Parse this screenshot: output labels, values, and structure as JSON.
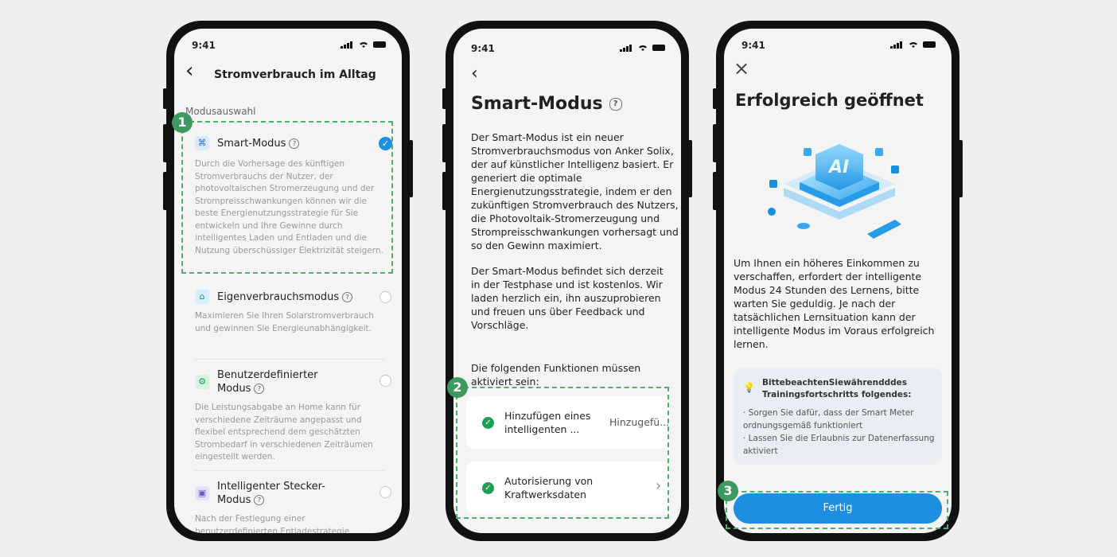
{
  "status": {
    "time": "9:41"
  },
  "screen1": {
    "back_label": "‹",
    "title": "Stromverbrauch im Alltag",
    "section_label": "Modusauswahl",
    "badge": "1",
    "modes": [
      {
        "name": "Smart-Modus",
        "icon": "ai-mode-icon",
        "selected": true,
        "desc": "Durch die Vorhersage des künftigen Stromverbrauchs der Nutzer, der photovoltaischen Stromerzeugung und der Strompreisschwankungen können wir die beste Energienutzungsstrategie für Sie entwickeln und Ihre Gewinne durch intelligentes Laden und Entladen und die Nutzung überschüssiger Elektrizität steigern."
      },
      {
        "name": "Eigenverbrauchsmodus",
        "icon": "home-icon",
        "selected": false,
        "desc": "Maximieren Sie Ihren Solarstromverbrauch und gewinnen Sie Energieunabhängigkeit."
      },
      {
        "name": "Benutzerdefinierter Modus",
        "name_line1": "Benutzerdefinierter",
        "name_line2": "Modus",
        "icon": "gear-icon",
        "selected": false,
        "desc": "Die Leistungsabgabe an Home kann für verschiedene Zeiträume angepasst und flexibel entsprechend dem geschätzten Strombedarf in verschiedenen Zeiträumen eingestellt werden."
      },
      {
        "name": "Intelligenter Stecker-Modus",
        "name_line1": "Intelligenter Stecker-",
        "name_line2": "Modus",
        "icon": "plug-icon",
        "selected": false,
        "desc": "Nach der Festlegung einer benutzerdefinierten Entladestrategie"
      }
    ]
  },
  "screen2": {
    "back_label": "‹",
    "title": "Smart-Modus",
    "description": "Der Smart-Modus ist ein neuer Stromverbrauchsmodus von Anker Solix, der auf künstlicher Intelligenz basiert. Er generiert die optimale Energienutzungsstrategie, indem er den zukünftigen Stromverbrauch des Nutzers, die Photovoltaik-Stromerzeugung und Strompreisschwankungen vorhersagt und so den Gewinn maximiert.",
    "description2": "Der Smart-Modus befindet sich derzeit in der Testphase und ist kostenlos. Wir laden herzlich ein, ihn auszuprobieren und freuen uns über Feedback und Vorschläge.",
    "requirements_heading": "Die folgenden Funktionen müssen aktiviert sein:",
    "badge": "2",
    "requirements": [
      {
        "label_line1": "Hinzufügen eines",
        "label_line2": "intelligenten ...",
        "status": "Hinzugefü..."
      },
      {
        "label_line1": "Autorisierung von",
        "label_line2": "Kraftwerksdaten",
        "status": "›"
      }
    ]
  },
  "screen3": {
    "close_label": "×",
    "title": "Erfolgreich geöffnet",
    "illustration_text": "AI",
    "description": "Um Ihnen ein höheres Einkommen zu verschaffen, erfordert der intelligente Modus 24 Stunden des Lernens, bitte warten Sie geduldig. Je nach der tatsächlichen Lernsituation kann der intelligente Modus im Voraus erfolgreich lernen.",
    "notice_title": "BittebeachtenSiewährendddes Trainingsfortschritts folgendes:",
    "notice_items": [
      "· Sorgen Sie dafür, dass der Smart Meter ordnungsgemäß funktioniert",
      "· Lassen Sie die Erlaubnis zur Datenerfassung aktiviert"
    ],
    "button_label": "Fertig",
    "badge": "3"
  },
  "colors": {
    "accent": "#1d8fe0",
    "badge": "#3c9a5f",
    "highlight": "#4caf6a"
  }
}
